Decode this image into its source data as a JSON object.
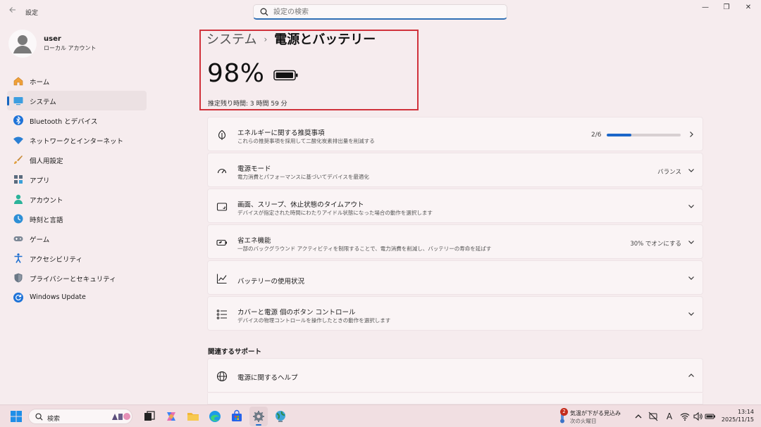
{
  "window": {
    "title": "設定",
    "controls": {
      "minimize": "—",
      "maximize": "❐",
      "close": "✕"
    }
  },
  "search": {
    "placeholder": "設定の検索"
  },
  "profile": {
    "name": "user",
    "account_type": "ローカル アカウント"
  },
  "sidebar": {
    "items": [
      {
        "label": "ホーム",
        "icon": "home-icon",
        "active": false
      },
      {
        "label": "システム",
        "icon": "system-icon",
        "active": true
      },
      {
        "label": "Bluetooth とデバイス",
        "icon": "bluetooth-icon",
        "active": false
      },
      {
        "label": "ネットワークとインターネット",
        "icon": "wifi-icon",
        "active": false
      },
      {
        "label": "個人用設定",
        "icon": "brush-icon",
        "active": false
      },
      {
        "label": "アプリ",
        "icon": "apps-icon",
        "active": false
      },
      {
        "label": "アカウント",
        "icon": "account-icon",
        "active": false
      },
      {
        "label": "時刻と言語",
        "icon": "globe-clock-icon",
        "active": false
      },
      {
        "label": "ゲーム",
        "icon": "gamepad-icon",
        "active": false
      },
      {
        "label": "アクセシビリティ",
        "icon": "accessibility-icon",
        "active": false
      },
      {
        "label": "プライバシーとセキュリティ",
        "icon": "shield-icon",
        "active": false
      },
      {
        "label": "Windows Update",
        "icon": "update-icon",
        "active": false
      }
    ]
  },
  "header": {
    "parent": "システム",
    "separator": "›",
    "current": "電源とバッテリー",
    "battery_percent": "98%",
    "battery_level": 0.98,
    "estimated_time": "推定残り時間: 3 時間 59 分"
  },
  "cards": [
    {
      "title": "エネルギーに関する推奨事項",
      "subtitle": "これらの推奨事項を採用して二酸化炭素排出量を削減する",
      "right": "2/6",
      "progress": 0.333,
      "icon": "leaf-icon",
      "chevron": "right"
    },
    {
      "title": "電源モード",
      "subtitle": "電力消費とパフォーマンスに基づいてデバイスを最適化",
      "right": "バランス",
      "icon": "gauge-icon",
      "chevron": "down"
    },
    {
      "title": "画面、スリープ、休止状態のタイムアウト",
      "subtitle": "デバイスが指定された時間にわたりアイドル状態になった場合の動作を選択します",
      "right": "",
      "icon": "screen-sleep-icon",
      "chevron": "down"
    },
    {
      "title": "省エネ機能",
      "subtitle": "一部のバックグラウンド アクティビティを制限することで、電力消費を削減し、バッテリーの寿命を延ばす",
      "right": "30% でオンにする",
      "icon": "battery-saver-icon",
      "chevron": "down"
    },
    {
      "title": "バッテリーの使用状況",
      "subtitle": "",
      "right": "",
      "icon": "chart-icon",
      "chevron": "down"
    },
    {
      "title": "カバーと電源 個のボタン コントロール",
      "subtitle": "デバイスの物理コントロールを操作したときの動作を選択します",
      "right": "",
      "icon": "list-controls-icon",
      "chevron": "down"
    }
  ],
  "support": {
    "heading": "関連するサポート",
    "help_title": "電源に関するヘルプ"
  },
  "taskbar": {
    "search_label": "検索",
    "weather_badge": "2",
    "weather_title": "気温が下がる見込み",
    "weather_sub": "次の火曜日",
    "time": "13:14",
    "date": "2025/11/15",
    "ime": "A"
  }
}
